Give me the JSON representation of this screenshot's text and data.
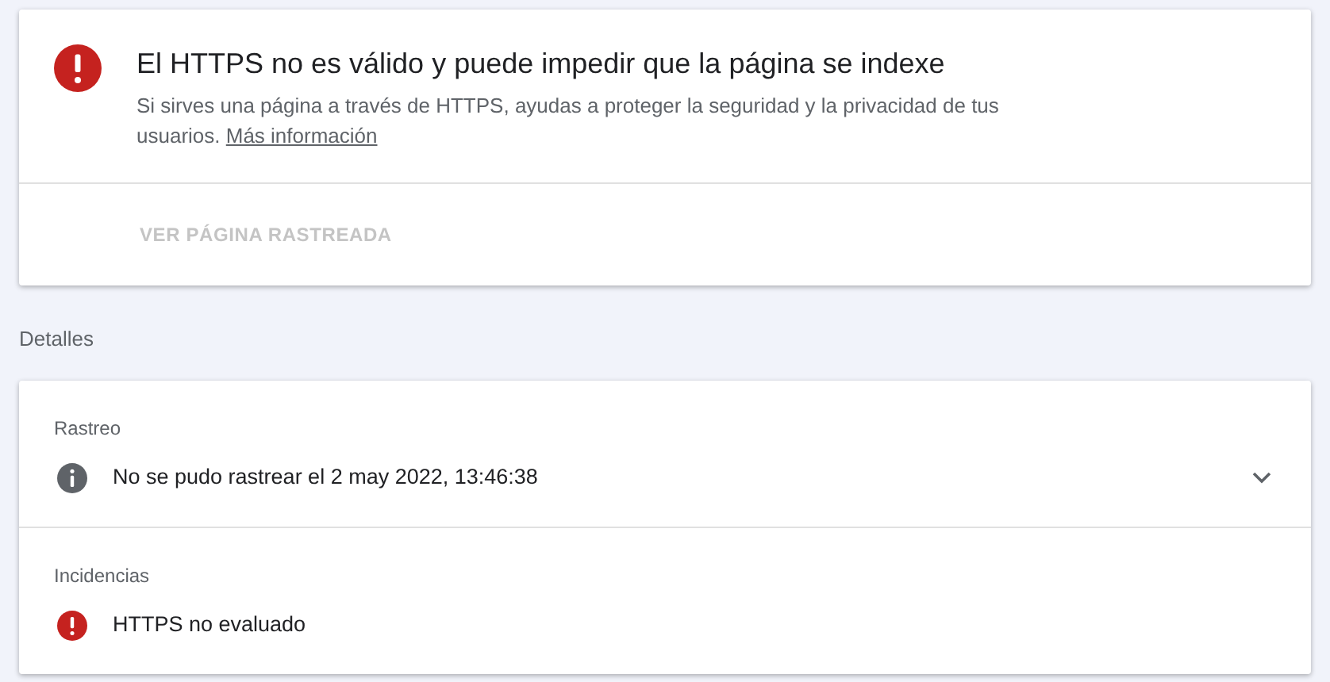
{
  "issue": {
    "kind": "error",
    "title": "El HTTPS no es válido y puede impedir que la página se indexe",
    "description": "Si sirves una página a través de HTTPS, ayudas a proteger la seguridad y la privacidad de tus usuarios.",
    "link": "Más información",
    "action": {
      "label": "VER PÁGINA RASTREADA",
      "disabled": true
    }
  },
  "details_heading": "Detalles",
  "sections": [
    {
      "label": "Rastreo",
      "items": [
        {
          "kind": "info",
          "text": "No se pudo rastrear el 2 may 2022, 13:46:38",
          "expandable": true
        }
      ]
    },
    {
      "label": "Incidencias",
      "items": [
        {
          "kind": "error",
          "text": "HTTPS no evaluado",
          "expandable": false
        }
      ]
    }
  ]
}
